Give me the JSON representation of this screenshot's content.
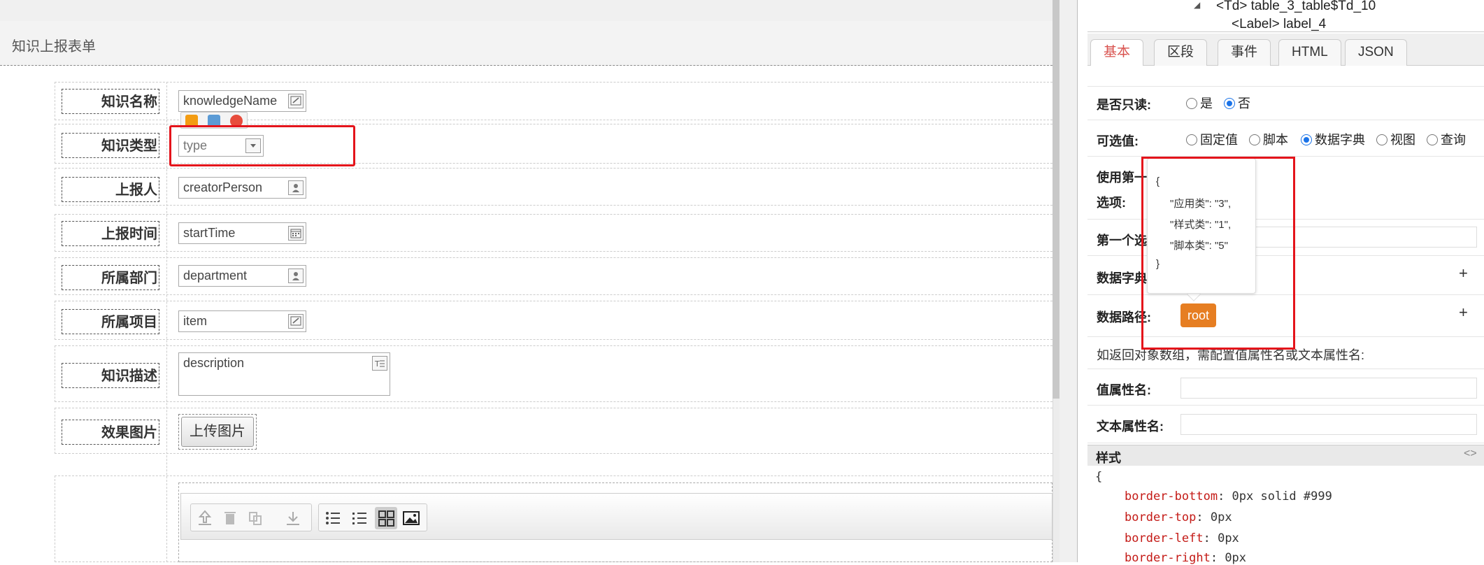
{
  "form": {
    "title": "知识上报表单",
    "fields": [
      {
        "label": "知识名称",
        "value": "knowledgeName",
        "icon": "edit-icon"
      },
      {
        "label": "知识类型",
        "value": "type",
        "icon": "dropdown-icon"
      },
      {
        "label": "上报人",
        "value": "creatorPerson",
        "icon": "user-icon"
      },
      {
        "label": "上报时间",
        "value": "startTime",
        "icon": "calendar-icon"
      },
      {
        "label": "所属部门",
        "value": "department",
        "icon": "user-icon"
      },
      {
        "label": "所属项目",
        "value": "item",
        "icon": "edit-icon"
      },
      {
        "label": "知识描述",
        "value": "description",
        "icon": "textarea-icon"
      },
      {
        "label": "效果图片",
        "button": "上传图片"
      }
    ]
  },
  "tree": {
    "line1": "<Td> table_3_table$Td_10",
    "line2": "<Label> label_4"
  },
  "tabs": [
    "基本",
    "区段",
    "事件",
    "HTML",
    "JSON"
  ],
  "props": {
    "readonly_label": "是否只读:",
    "readonly_options": [
      "是",
      "否"
    ],
    "optional_label": "可选值:",
    "optional_options": [
      "固定值",
      "脚本",
      "数据字典",
      "视图",
      "查询"
    ],
    "use_first_label": "使用第一",
    "options_label": "选项:",
    "first_label": "第一个选",
    "dict_label": "数据字典",
    "path_label": "数据路径:",
    "hint": "如返回对象数组，需配置值属性名或文本属性名:",
    "value_attr_label": "值属性名:",
    "text_attr_label": "文本属性名:",
    "style_label": "样式"
  },
  "popup": {
    "open": "{",
    "l1": "\"应用类\": \"3\",",
    "l2": "\"样式类\": \"1\",",
    "l3": "\"脚本类\": \"5\"",
    "close": "}"
  },
  "root_badge": "root",
  "style_code": {
    "open": "{",
    "lines": [
      {
        "k": "border-bottom",
        "v": "0px solid #999"
      },
      {
        "k": "border-top",
        "v": "0px"
      },
      {
        "k": "border-left",
        "v": "0px"
      },
      {
        "k": "border-right",
        "v": "0px"
      }
    ]
  },
  "colors": {
    "accent": "#e67e22",
    "highlight": "#e4141b",
    "active_tab": "#d9534f"
  }
}
